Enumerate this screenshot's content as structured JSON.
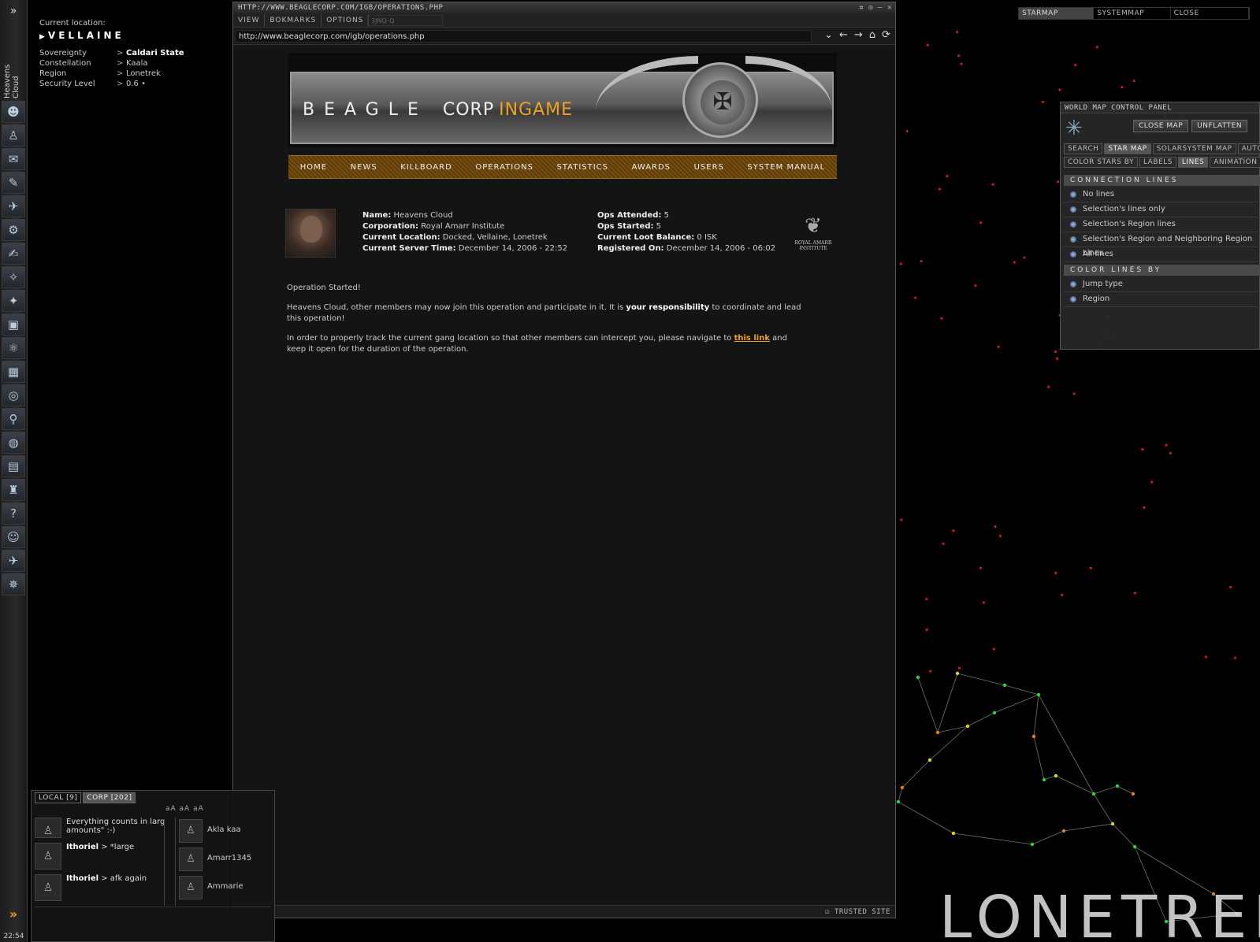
{
  "sidebar": {
    "pilot_name": "Heavens Cloud",
    "clock": "22:54",
    "tools": [
      {
        "icon": "character-sheet-icon",
        "glyph": "☻"
      },
      {
        "icon": "people-icon",
        "glyph": "♙"
      },
      {
        "icon": "mail-icon",
        "glyph": "✉"
      },
      {
        "icon": "notepad-icon",
        "glyph": "✎"
      },
      {
        "icon": "ship-icon",
        "glyph": "✈"
      },
      {
        "icon": "cargo-icon",
        "glyph": "⚙"
      },
      {
        "icon": "journal-icon",
        "glyph": "✍"
      },
      {
        "icon": "map-icon",
        "glyph": "✧"
      },
      {
        "icon": "fitting-icon",
        "glyph": "✦"
      },
      {
        "icon": "assets-icon",
        "glyph": "▣"
      },
      {
        "icon": "science-icon",
        "glyph": "⚛"
      },
      {
        "icon": "calculator-icon",
        "glyph": "▦"
      },
      {
        "icon": "help-buoy-icon",
        "glyph": "◎"
      },
      {
        "icon": "scanner-icon",
        "glyph": "⚲"
      },
      {
        "icon": "browser-globe-icon",
        "glyph": "◍"
      },
      {
        "icon": "market-icon",
        "glyph": "▤"
      },
      {
        "icon": "corporation-icon",
        "glyph": "♜"
      },
      {
        "icon": "info-icon",
        "glyph": "?"
      },
      {
        "icon": "character-face-icon",
        "glyph": "☺"
      },
      {
        "icon": "ships-hangar-icon",
        "glyph": "✈"
      },
      {
        "icon": "drones-icon",
        "glyph": "✵"
      }
    ]
  },
  "location": {
    "current_label": "Current location:",
    "system": "VELLAINE",
    "rows": [
      {
        "key": "Sovereignty",
        "value": "Caldari State"
      },
      {
        "key": "Constellation",
        "value": "Kaala"
      },
      {
        "key": "Region",
        "value": "Lonetrek"
      },
      {
        "key": "Security Level",
        "value": "0.6"
      }
    ],
    "security_color": "#aacc44"
  },
  "browser": {
    "title": "HTTP://WWW.BEAGLECORP.COM/IGB/OPERATIONS.PHP",
    "menu": [
      "VIEW",
      "BOKMARKS",
      "OPTIONS"
    ],
    "ghost_item": "3JNQ-Q",
    "url": "http://www.beaglecorp.com/igb/operations.php",
    "status": "TRUSTED SITE"
  },
  "site": {
    "banner_title_a": "BEAGLE",
    "banner_title_b": "CORP",
    "banner_title_c": "INGAME",
    "nav": [
      "Home",
      "News",
      "Killboard",
      "Operations",
      "Statistics",
      "Awards",
      "Users",
      "System Manual"
    ],
    "profile": {
      "left": [
        {
          "label": "Name:",
          "value": "Heavens Cloud"
        },
        {
          "label": "Corporation:",
          "value": "Royal Amarr Institute"
        },
        {
          "label": "Current Location:",
          "value": "Docked, Vellaine, Lonetrek"
        },
        {
          "label": "Current Server Time:",
          "value": "December 14, 2006 - 22:52"
        }
      ],
      "right": [
        {
          "label": "Ops Attended:",
          "value": "5"
        },
        {
          "label": "Ops Started:",
          "value": "5"
        },
        {
          "label": "Current Loot Balance:",
          "value": "0 ISK"
        },
        {
          "label": "Registered On:",
          "value": "December 14, 2006 - 06:02"
        }
      ],
      "corp_logo_line1": "ROYAL AMARR",
      "corp_logo_line2": "INSTITUTE"
    },
    "message": {
      "line1": "Operation Started!",
      "line2_a": "Heavens Cloud, other members may now join this operation and participate in it. It is ",
      "line2_b": "your responsibility",
      "line2_c": " to coordinate and lead this operation!",
      "line3_a": "In order to properly track the current gang location so that other members can intercept you, please navigate to ",
      "line3_link": "this link",
      "line3_b": " and keep it open for the duration of the operation."
    },
    "accent": "#f0a020"
  },
  "maptabs": [
    "STARMAP",
    "SYSTEMMAP",
    "CLOSE"
  ],
  "wmcp": {
    "title": "WORLD MAP CONTROL PANEL",
    "buttons": [
      "CLOSE MAP",
      "UNFLATTEN"
    ],
    "tabs1": [
      "SEARCH",
      "STAR MAP",
      "SOLARSYSTEM MAP",
      "AUTOPIL"
    ],
    "tabs2": [
      "COLOR STARS BY",
      "LABELS",
      "LINES",
      "ANIMATION"
    ],
    "section1": "CONNECTION LINES",
    "options1": [
      "No lines",
      "Selection's lines only",
      "Selection's Region lines",
      "Selection's Region and Neighboring Region Lines",
      "All lines"
    ],
    "section2": "COLOR LINES BY",
    "options2": [
      "Jump type",
      "Region"
    ]
  },
  "chat": {
    "tabs": [
      "LOCAL [9]",
      "CORP [202]"
    ],
    "toolbar": "aA aA aA",
    "first_line": "Everything counts in larg amounts\" :-)",
    "messages": [
      {
        "author": "Ithoriel",
        "text": " > *large"
      },
      {
        "author": "Ithoriel",
        "text": " > afk again"
      }
    ],
    "members": [
      "Akla kaa",
      "Amarr1345",
      "Ammarie"
    ]
  },
  "region_label": "LONETREK"
}
